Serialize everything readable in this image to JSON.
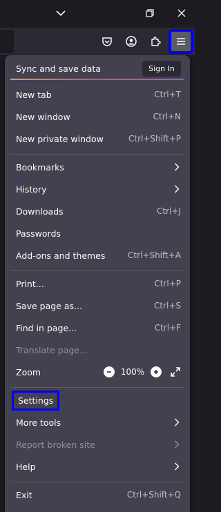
{
  "titlebar": {
    "icons": [
      "chevron-down-icon",
      "restore-icon",
      "close-icon"
    ]
  },
  "toolbar": {
    "icons": [
      "pocket-icon",
      "account-icon",
      "extensions-icon",
      "hamburger-menu-icon"
    ]
  },
  "menu": {
    "sync": {
      "label": "Sync and save data",
      "button": "Sign In"
    },
    "items": {
      "new_tab": {
        "label": "New tab",
        "shortcut": "Ctrl+T"
      },
      "new_window": {
        "label": "New window",
        "shortcut": "Ctrl+N"
      },
      "new_private_window": {
        "label": "New private window",
        "shortcut": "Ctrl+Shift+P"
      },
      "bookmarks": {
        "label": "Bookmarks"
      },
      "history": {
        "label": "History"
      },
      "downloads": {
        "label": "Downloads",
        "shortcut": "Ctrl+J"
      },
      "passwords": {
        "label": "Passwords"
      },
      "addons": {
        "label": "Add-ons and themes",
        "shortcut": "Ctrl+Shift+A"
      },
      "print": {
        "label": "Print...",
        "shortcut": "Ctrl+P"
      },
      "save_page": {
        "label": "Save page as...",
        "shortcut": "Ctrl+S"
      },
      "find": {
        "label": "Find in page...",
        "shortcut": "Ctrl+F"
      },
      "translate": {
        "label": "Translate page..."
      },
      "zoom": {
        "label": "Zoom",
        "value": "100%"
      },
      "settings": {
        "label": "Settings"
      },
      "more_tools": {
        "label": "More tools"
      },
      "report_broken": {
        "label": "Report broken site"
      },
      "help": {
        "label": "Help"
      },
      "exit": {
        "label": "Exit",
        "shortcut": "Ctrl+Shift+Q"
      }
    }
  },
  "colors": {
    "highlight": "#0000ff",
    "panel_bg": "#42414d",
    "text": "#fbfbfe"
  }
}
